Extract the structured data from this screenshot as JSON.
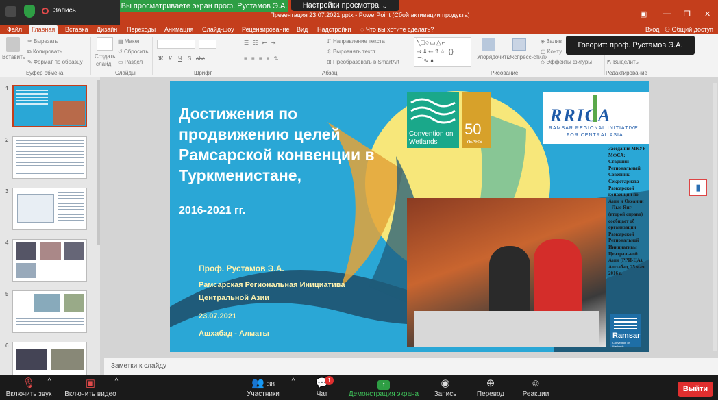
{
  "zoom": {
    "recording_label": "Запись",
    "share_banner": "Вы просматриваете экран проф.  Рустамов Э.А.",
    "view_options": "Настройки просмотра",
    "speaker": "Говорит: проф.  Рустамов Э.А.",
    "bottom": [
      {
        "label": "Включить звук",
        "icon": "microphone-muted-icon"
      },
      {
        "label": "Включить видео",
        "icon": "camera-muted-icon"
      },
      {
        "label": "Участники",
        "icon": "participants-icon",
        "count": "38"
      },
      {
        "label": "Чат",
        "icon": "chat-icon",
        "badge": "1"
      },
      {
        "label": "Демонстрация экрана",
        "icon": "share-screen-icon"
      },
      {
        "label": "Запись",
        "icon": "record-icon"
      },
      {
        "label": "Перевод",
        "icon": "globe-icon"
      },
      {
        "label": "Реакции",
        "icon": "emoji-icon"
      }
    ],
    "leave": "Выйти",
    "colors": {
      "share_green": "#2e9e44",
      "leave_red": "#e02f2f"
    }
  },
  "ppt": {
    "title": "Презентация 23.07.2021.pptx - PowerPoint (Сбой активации продукта)",
    "signin": "Вход",
    "share": "Общий доступ",
    "tabs": [
      "Файл",
      "Главная",
      "Вставка",
      "Дизайн",
      "Переходы",
      "Анимация",
      "Слайд-шоу",
      "Рецензирование",
      "Вид",
      "Надстройки",
      "Что вы хотите сделать?"
    ],
    "active_tab": "Главная",
    "ribbon": {
      "paste": "Вставить",
      "cut": "Вырезать",
      "copy": "Копировать",
      "format_painter": "Формат по образцу",
      "clipboard": "Буфер обмена",
      "new_slide": "Создать",
      "new_slide2": "слайд",
      "layout": "Макет",
      "reset": "Сбросить",
      "section": "Раздел",
      "slides": "Слайды",
      "font": "Шрифт",
      "text_dir": "Направление текста",
      "align_text": "Выровнять текст",
      "smartart": "Преобразовать в SmartArt",
      "paragraph": "Абзац",
      "arrange": "Упорядочить",
      "styles": "Экспресс-стили",
      "fill": "Залив",
      "outline": "Конту",
      "effects": "Эффекты фигуры",
      "drawing": "Рисование",
      "select": "Выделить",
      "editing": "Редактирование",
      "font_bold": "Ж",
      "font_italic": "К",
      "font_underline": "Ч",
      "font_strike": "S",
      "font_sub": "abc"
    },
    "notes_placeholder": "Заметки к слайду",
    "slide_numbers": [
      "1",
      "2",
      "3",
      "4",
      "5",
      "6"
    ],
    "accent": "#c43e1c"
  },
  "slide": {
    "title": "Достижения по продвижению целей Рамсарской конвенции в Туркменистане,",
    "years": "2016-2021 гг.",
    "author": "Проф. Рустамов Э.А.",
    "org1": "Рамсарская Региональная Инициатива",
    "org2": "Центральной Азии",
    "date": "23.07.2021",
    "place": "Ашхабад - Алматы",
    "cow1": "Convention on",
    "cow2": "Wetlands",
    "fifty": "50",
    "years_badge": "YEARS",
    "rrica_logo": "RRICA",
    "rrica_sub1": "RAMSAR REGIONAL INITIATIVE",
    "rrica_sub2": "FOR CENTRAL ASIA",
    "ramsar": "Ramsar",
    "ramsar_sub": "Convention on Wetlands",
    "caption": "Заседание МКУР МФСА: Старший Региональный Советник Секретариата Рамсарской конвенции по Азии и Океании – Лью Янг (второй справа) сообщает об организации Рамсарской Региональной Инициативы Центральной Азии (РРИ-ЦА). Ашхабад, 25 мая 2016 г."
  }
}
